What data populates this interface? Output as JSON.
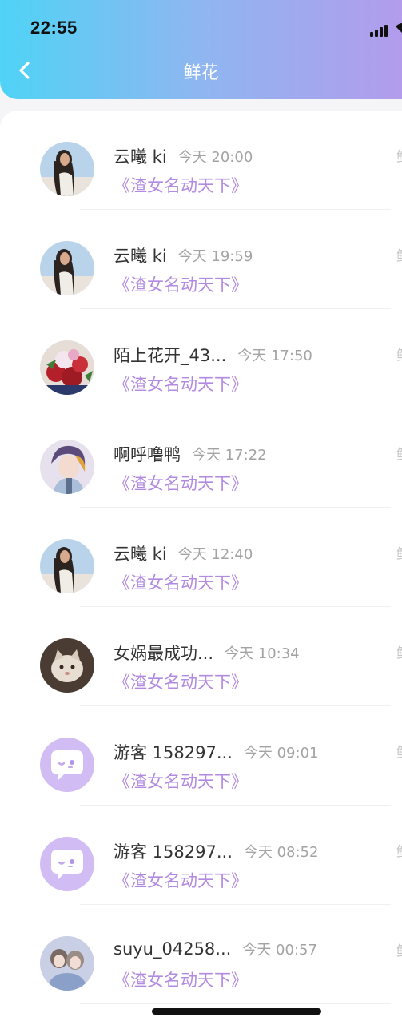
{
  "status_bar": {
    "time": "22:55"
  },
  "header": {
    "title": "鲜花"
  },
  "colors": {
    "accent_purple": "#b28ae0",
    "header_gradient": [
      "#4fd3f6",
      "#b29ceb"
    ]
  },
  "list": [
    {
      "name": "云曦 ki",
      "time": "今天 20:00",
      "book": "《渣女名动天下》",
      "avatar": "girl-sky-photo"
    },
    {
      "name": "云曦 ki",
      "time": "今天 19:59",
      "book": "《渣女名动天下》",
      "avatar": "girl-sky-photo"
    },
    {
      "name": "陌上花开_43...",
      "time": "今天 17:50",
      "book": "《渣女名动天下》",
      "avatar": "flower-bouquet-photo"
    },
    {
      "name": "啊呼噜鸭",
      "time": "今天 17:22",
      "book": "《渣女名动天下》",
      "avatar": "anime-boy-photo"
    },
    {
      "name": "云曦 ki",
      "time": "今天 12:40",
      "book": "《渣女名动天下》",
      "avatar": "girl-sky-photo"
    },
    {
      "name": "女娲最成功...",
      "time": "今天 10:34",
      "book": "《渣女名动天下》",
      "avatar": "cat-photo"
    },
    {
      "name": "游客 158297...",
      "time": "今天 09:01",
      "book": "《渣女名动天下》",
      "avatar": "default-chat-bubble"
    },
    {
      "name": "游客 158297...",
      "time": "今天 08:52",
      "book": "《渣女名动天下》",
      "avatar": "default-chat-bubble"
    },
    {
      "name": "suyu_04258...",
      "time": "今天 00:57",
      "book": "《渣女名动天下》",
      "avatar": "anime-couple-photo"
    }
  ]
}
